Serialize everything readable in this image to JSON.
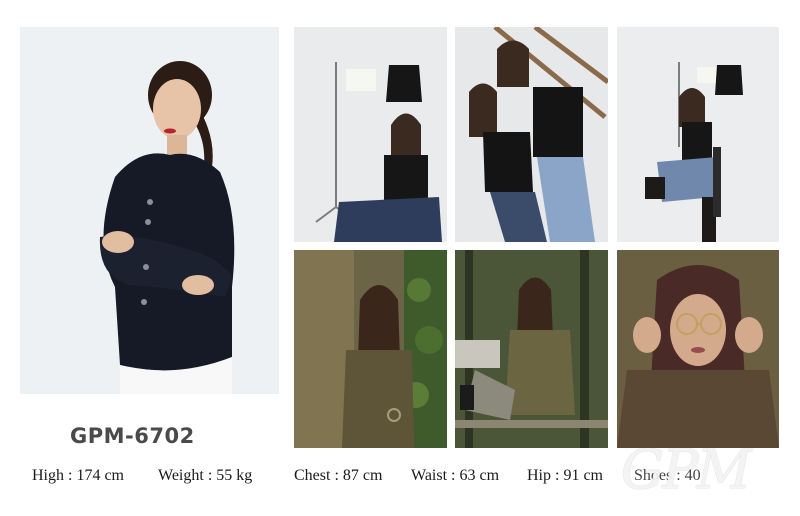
{
  "model": {
    "code": "GPM-6702"
  },
  "measurements": {
    "height": "High : 174 cm",
    "weight": "Weight : 55 kg",
    "chest": "Chest : 87 cm",
    "waist": "Waist : 63 cm",
    "hip": "Hip : 91  cm",
    "shoes": "Shoes : 40"
  },
  "watermark": "GPM",
  "photos": {
    "main": "portrait-black-polka-dot-jacket",
    "studio": [
      "studio-seated-black-top",
      "studio-two-models-sunglasses",
      "studio-seated-boots"
    ],
    "outdoor": [
      "outdoor-ivy-wall-olive-jacket",
      "outdoor-bench-olive-jacket",
      "outdoor-glasses-closeup"
    ]
  },
  "colors": {
    "text": "#1a1a1a",
    "code_text": "#4a4a4a",
    "background": "#ffffff"
  }
}
